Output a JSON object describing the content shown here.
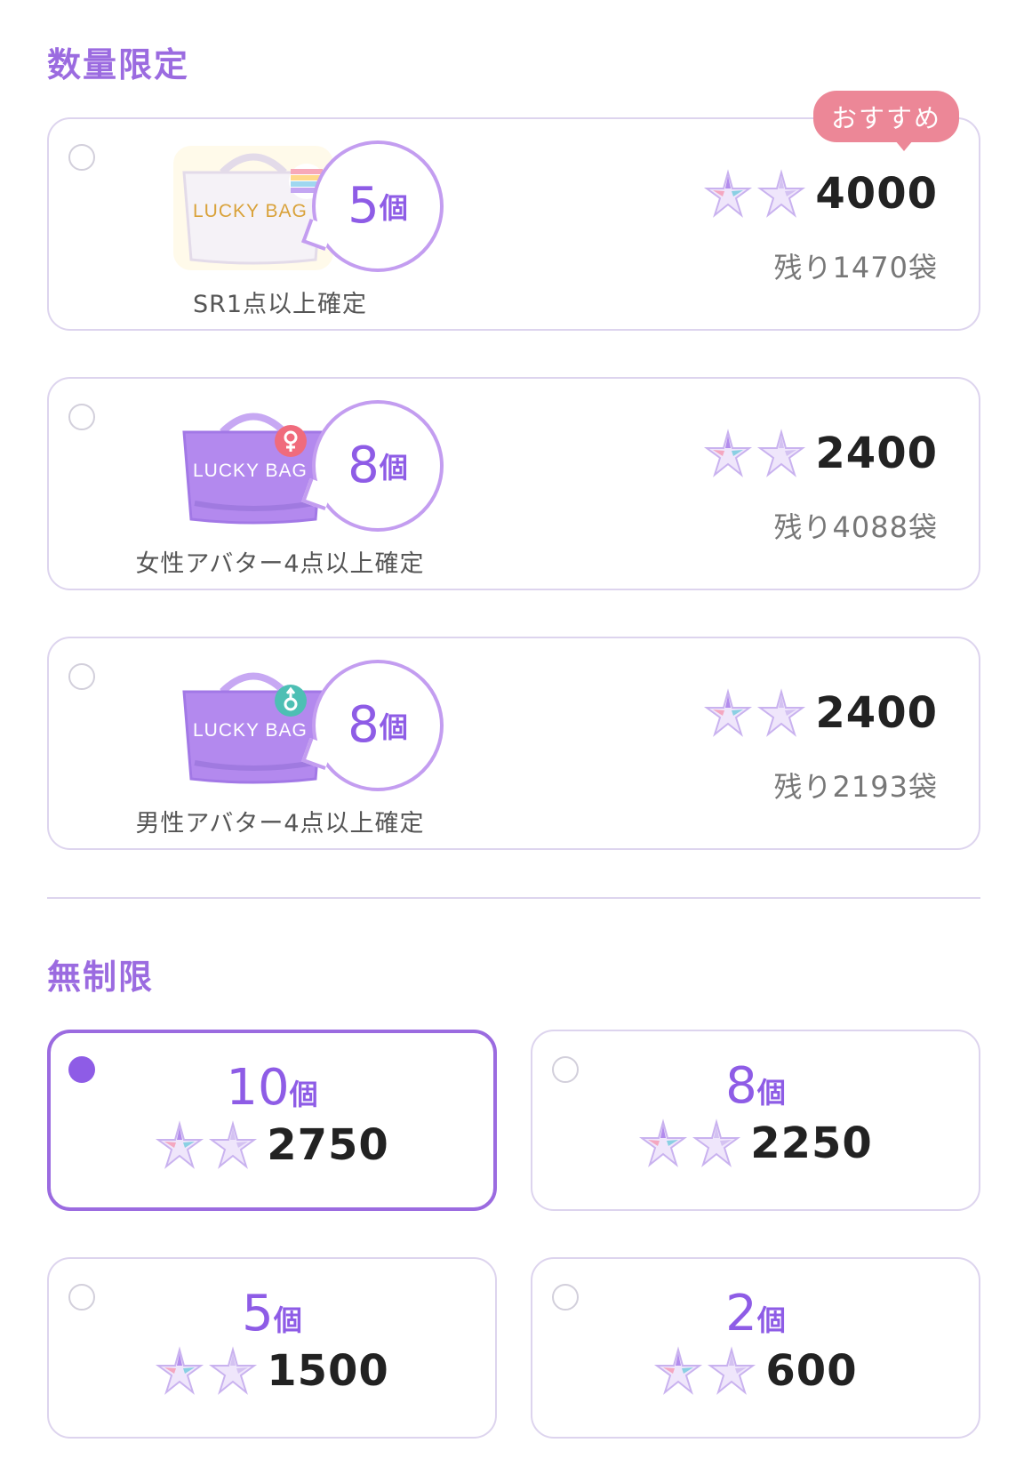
{
  "limited": {
    "title": "数量限定",
    "items": [
      {
        "bag_label": "LUCKY BAG",
        "count": "5",
        "unit": "個",
        "caption": "SR1点以上確定",
        "price": "4000",
        "remaining": "残り1470袋",
        "badge": "おすすめ",
        "selected": false
      },
      {
        "bag_label": "LUCKY BAG",
        "count": "8",
        "unit": "個",
        "caption": "女性アバター4点以上確定",
        "price": "2400",
        "remaining": "残り4088袋",
        "selected": false
      },
      {
        "bag_label": "LUCKY BAG",
        "count": "8",
        "unit": "個",
        "caption": "男性アバター4点以上確定",
        "price": "2400",
        "remaining": "残り2193袋",
        "selected": false
      }
    ]
  },
  "unlimited": {
    "title": "無制限",
    "items": [
      {
        "count": "10",
        "unit": "個",
        "price": "2750",
        "selected": true
      },
      {
        "count": "8",
        "unit": "個",
        "price": "2250",
        "selected": false
      },
      {
        "count": "5",
        "unit": "個",
        "price": "1500",
        "selected": false
      },
      {
        "count": "2",
        "unit": "個",
        "price": "600",
        "selected": false
      }
    ]
  },
  "colors": {
    "accent": "#9b6be0",
    "selected_radio": "#8e5ce6",
    "badge": "#ec8797",
    "bag_purple": "#b389ee",
    "female_symbol": "#f06b7c",
    "male_symbol": "#4dbfb4"
  },
  "icons": {
    "currency": "crystal-star-icon",
    "bag": "lucky-bag-icon"
  }
}
